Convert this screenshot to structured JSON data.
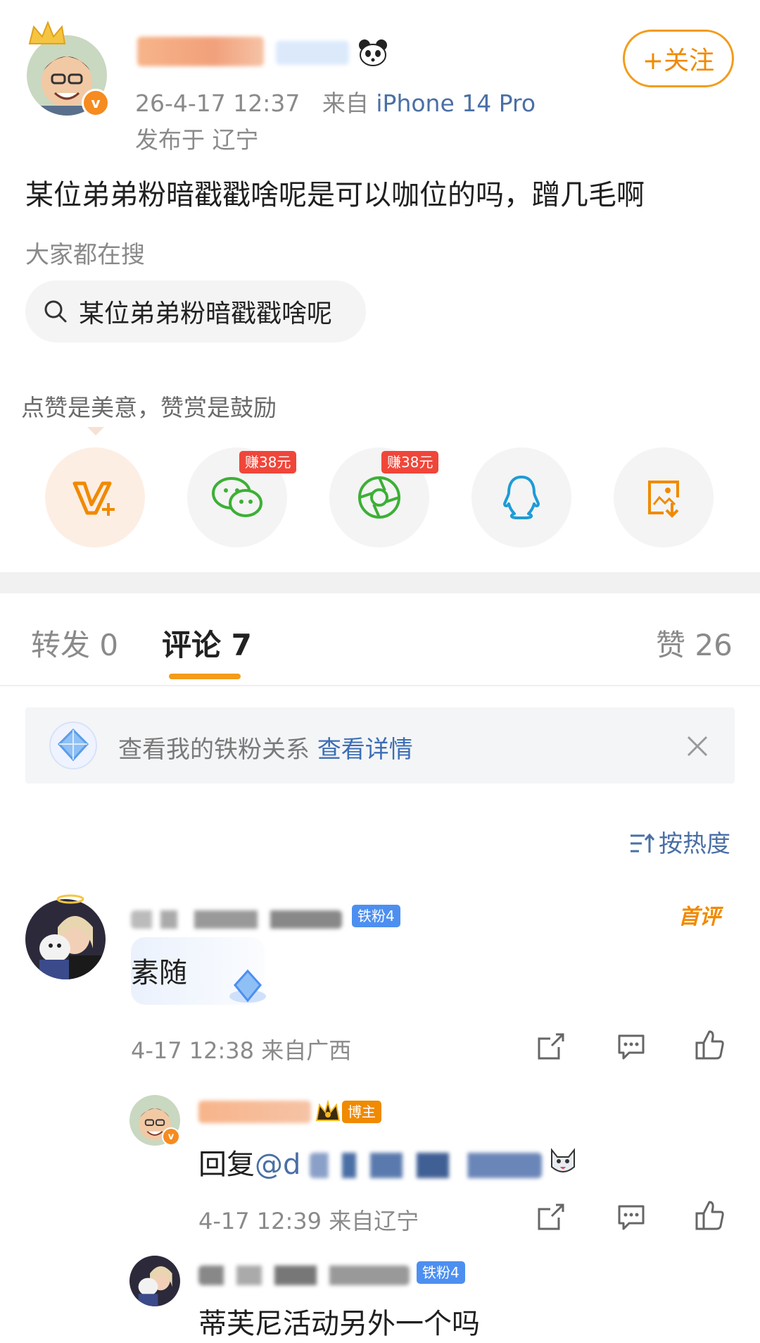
{
  "post": {
    "time": "26-4-17 12:37",
    "source_prefix": "来自",
    "device": "iPhone 14 Pro",
    "location": "发布于 辽宁",
    "follow_label": "+关注",
    "text": "某位弟弟粉暗戳戳啥呢是可以咖位的吗，蹭几毛啊"
  },
  "search": {
    "label": "大家都在搜",
    "query": "某位弟弟粉暗戳戳啥呢"
  },
  "reward": {
    "tip": "点赞是美意，赞赏是鼓励",
    "share_buttons": [
      {
        "icon": "v-plus-icon"
      },
      {
        "icon": "wechat-icon",
        "badge": "赚38元"
      },
      {
        "icon": "moments-icon",
        "badge": "赚38元"
      },
      {
        "icon": "qq-icon"
      },
      {
        "icon": "save-image-icon"
      }
    ]
  },
  "tabs": {
    "repost": "转发 0",
    "comments": "评论 7",
    "likes": "赞 26"
  },
  "fan_bar": {
    "text": "查看我的铁粉关系",
    "link": "查看详情"
  },
  "sort_label": "按热度",
  "comments": [
    {
      "tag": "铁粉4",
      "badge": "首评",
      "text": "素随",
      "meta": "4-17 12:38 来自广西"
    }
  ],
  "replies": [
    {
      "tag": "博主",
      "text_prefix": "回复",
      "mention": "@d",
      "meta": "4-17 12:39 来自辽宁"
    },
    {
      "tag": "铁粉4",
      "text": "蒂芙尼活动另外一个吗"
    }
  ],
  "colors": {
    "accent": "#f39c1b",
    "link": "#4a6fa5",
    "badge_red": "#f0463a",
    "fan_blue": "#4d8ff0"
  }
}
